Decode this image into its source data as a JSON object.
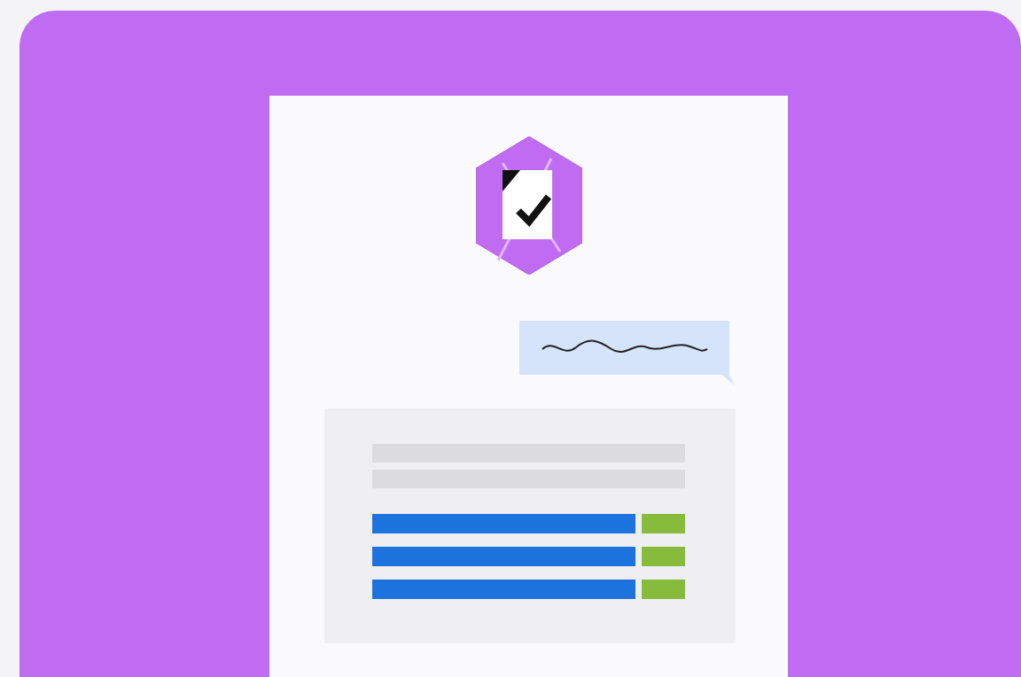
{
  "scene": {
    "kind": "chat",
    "rows": [
      {
        "kind": "line"
      },
      {
        "kind": "line"
      },
      {
        "kind": "bar"
      },
      {
        "kind": "bar"
      },
      {
        "kind": "bar"
      }
    ]
  }
}
